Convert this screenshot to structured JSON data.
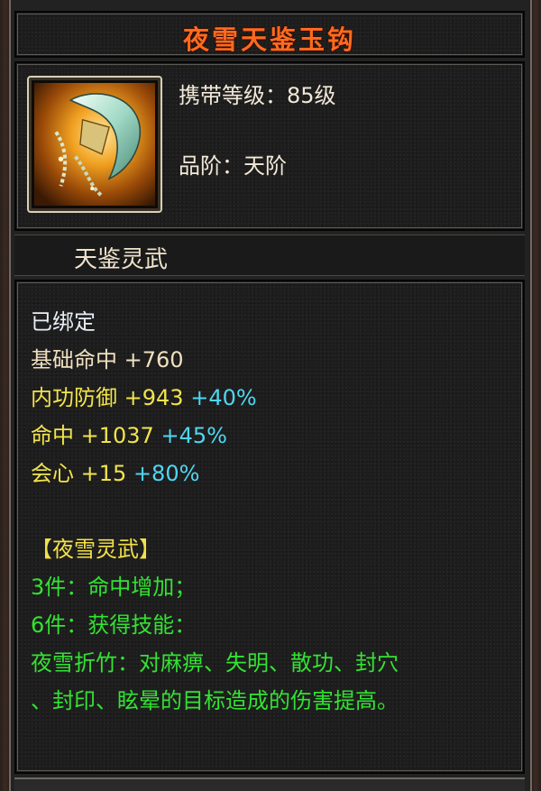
{
  "item": {
    "name": "夜雪天鉴玉钩",
    "level_label": "携带等级",
    "level_value": "85级",
    "grade_label": "品阶",
    "grade_value": "天阶",
    "category": "天鉴灵武",
    "icon": "golden-hook-weapon-icon"
  },
  "stats": {
    "bound": "已绑定",
    "base_hit_label": "基础命中",
    "base_hit_value": "+760",
    "inner_defense_label": "内功防御",
    "inner_defense_value": "+943",
    "inner_defense_bonus": "+40%",
    "hit_label": "命中",
    "hit_value": "+1037",
    "hit_bonus": "+45%",
    "crit_label": "会心",
    "crit_value": "+15",
    "crit_bonus": "+80%"
  },
  "set": {
    "name": "【夜雪灵武】",
    "piece3": "3件：命中增加；",
    "piece6": "6件：获得技能：",
    "skill_line1": "夜雪折竹：对麻痹、失明、散功、封穴",
    "skill_line2": "、封印、眩晕的目标造成的伤害提高。"
  },
  "colors": {
    "title": "#ff6a1f",
    "bound": "#e9edf6",
    "base_stat": "#f0e0c0",
    "extra_stat": "#f1e44c",
    "bonus": "#4fd6f2",
    "set_text": "#33e233",
    "set_name": "#f2e04a"
  }
}
